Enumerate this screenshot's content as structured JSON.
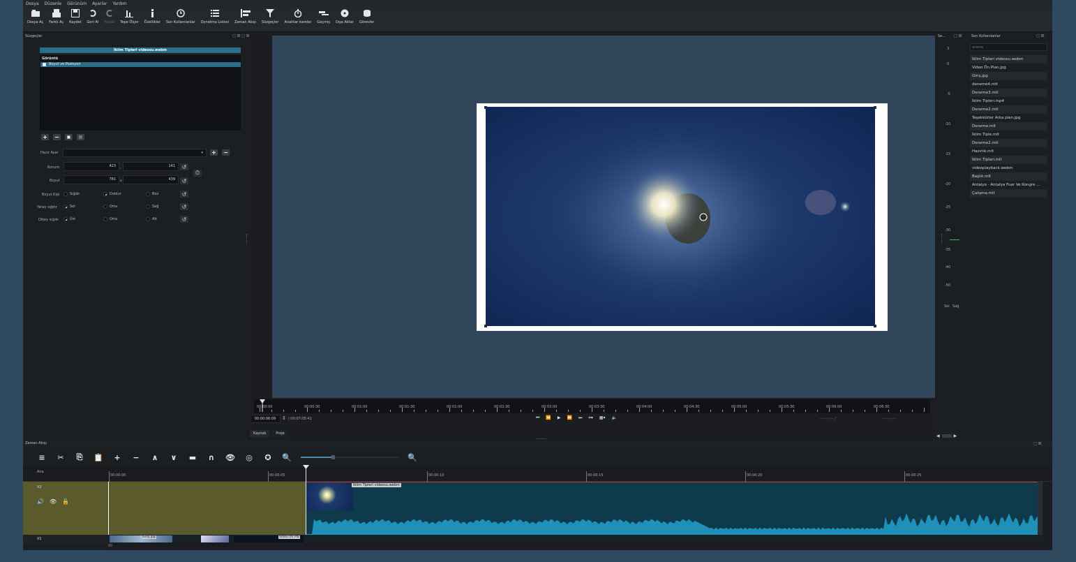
{
  "menu": [
    "Dosya",
    "Düzenle",
    "Görünüm",
    "Ayarlar",
    "Yardım"
  ],
  "toolbar": [
    {
      "label": "Dosya Aç",
      "icon": "open-icon"
    },
    {
      "label": "Farklı Aç",
      "icon": "open-other-icon"
    },
    {
      "label": "Kaydet",
      "icon": "save-icon"
    },
    {
      "label": "Geri Al",
      "icon": "undo-icon"
    },
    {
      "label": "Yinele",
      "icon": "redo-icon",
      "disabled": true
    },
    {
      "label": "Tepe Ölçer",
      "icon": "peak-meter-icon"
    },
    {
      "label": "Özellikler",
      "icon": "info-icon"
    },
    {
      "label": "Son Kullanılanlar",
      "icon": "clock-icon"
    },
    {
      "label": "Oynatma Listesi",
      "icon": "list-icon"
    },
    {
      "label": "Zaman Akışı",
      "icon": "timeline-icon"
    },
    {
      "label": "Süzgeçler",
      "icon": "filter-icon"
    },
    {
      "label": "Anahtar kareler",
      "icon": "stopwatch-icon"
    },
    {
      "label": "Geçmiş",
      "icon": "history-icon"
    },
    {
      "label": "Dışa Aktar",
      "icon": "export-icon"
    },
    {
      "label": "Görevler",
      "icon": "jobs-icon"
    }
  ],
  "filters": {
    "title": "Süzgeçler",
    "clip_name": "İklim Tipleri videosu.webm",
    "category": "Görüntü",
    "item": "Boyut ve Pozisyon",
    "preset_label": "Hazır Ayar",
    "position_label": "Konum",
    "position_x": "423",
    "position_sep": ",",
    "position_y": "141",
    "size_label": "Boyut",
    "size_w": "781",
    "size_sep": "x",
    "size_h": "439",
    "fit_label": "Boyut Kipi",
    "fit_options": [
      "Sığdır",
      "Doldur",
      "Boz"
    ],
    "halign_label": "Yatay sığdır",
    "halign_options": [
      "Sol",
      "Orta",
      "Sağ"
    ],
    "valign_label": "Dikey sığdır",
    "valign_options": [
      "Üst",
      "Orta",
      "Alt"
    ]
  },
  "ruler_labels": [
    "00:00:00",
    "00:00:30",
    "00:01:00",
    "00:01:30",
    "00:02:00",
    "00:02:30",
    "00:03:00",
    "00:03:30",
    "00:04:00",
    "00:04:30",
    "00:05:00",
    "00:05:30",
    "00:06:00",
    "00:06:30"
  ],
  "transport": {
    "current_time": "00:00:06:09",
    "total_time": "/ 00:07:05:41",
    "in_point": "--:--:--:-- /",
    "out_point": "--:--:--:--",
    "tabs": [
      "Kaynak",
      "Proje"
    ]
  },
  "meter": {
    "title": "Se...",
    "scale": [
      "3",
      "0",
      "-5",
      "-10",
      "-15",
      "-20",
      "-25",
      "-30",
      "-35",
      "-40",
      "-50"
    ],
    "left": "Sol",
    "right": "Sağ"
  },
  "recent": {
    "title": "Son Kullanılanlar",
    "search_placeholder": "arama",
    "items": [
      "İklim Tipleri videosu.webm",
      "Video Ön Plan.jpg",
      "Giriş.jpg",
      "deneme4.mlt",
      "Deneme3.mlt",
      "İklim Tipleri.mp4",
      "Deneme2.mlt",
      "Teşekkürler Arka plan.jpg",
      "Deneme.mlt",
      "İklim Tiple.mlt",
      "Deneme2.mlt",
      "Hazırlık.mlt",
      "İklim Tipleri.mlt",
      "videoplayback.webm",
      "Başlık.mlt",
      "Antalya - Antalya Fuar Ve Kongre ...",
      "Çalışma.mlt"
    ]
  },
  "timeline": {
    "title": "Zaman Akışı",
    "header_label": "Ana",
    "ruler": [
      "00:00:00",
      "00:00:05",
      "00:00:10",
      "00:00:15",
      "00:00:20",
      "00:00:25"
    ],
    "tracks": [
      "V2",
      "V1"
    ],
    "v2_clip": "İklim Tipleri videosu.webm",
    "v1_clips": [
      "Giriş.jpg",
      "Video Ön Pla"
    ]
  },
  "colors": {
    "accent": "#2b6e8a",
    "viewer_bg": "#31465a",
    "v2_clip": "#0e3a4b",
    "waveform": "#1f90b8",
    "olive_selection": "#5a5a2c"
  }
}
